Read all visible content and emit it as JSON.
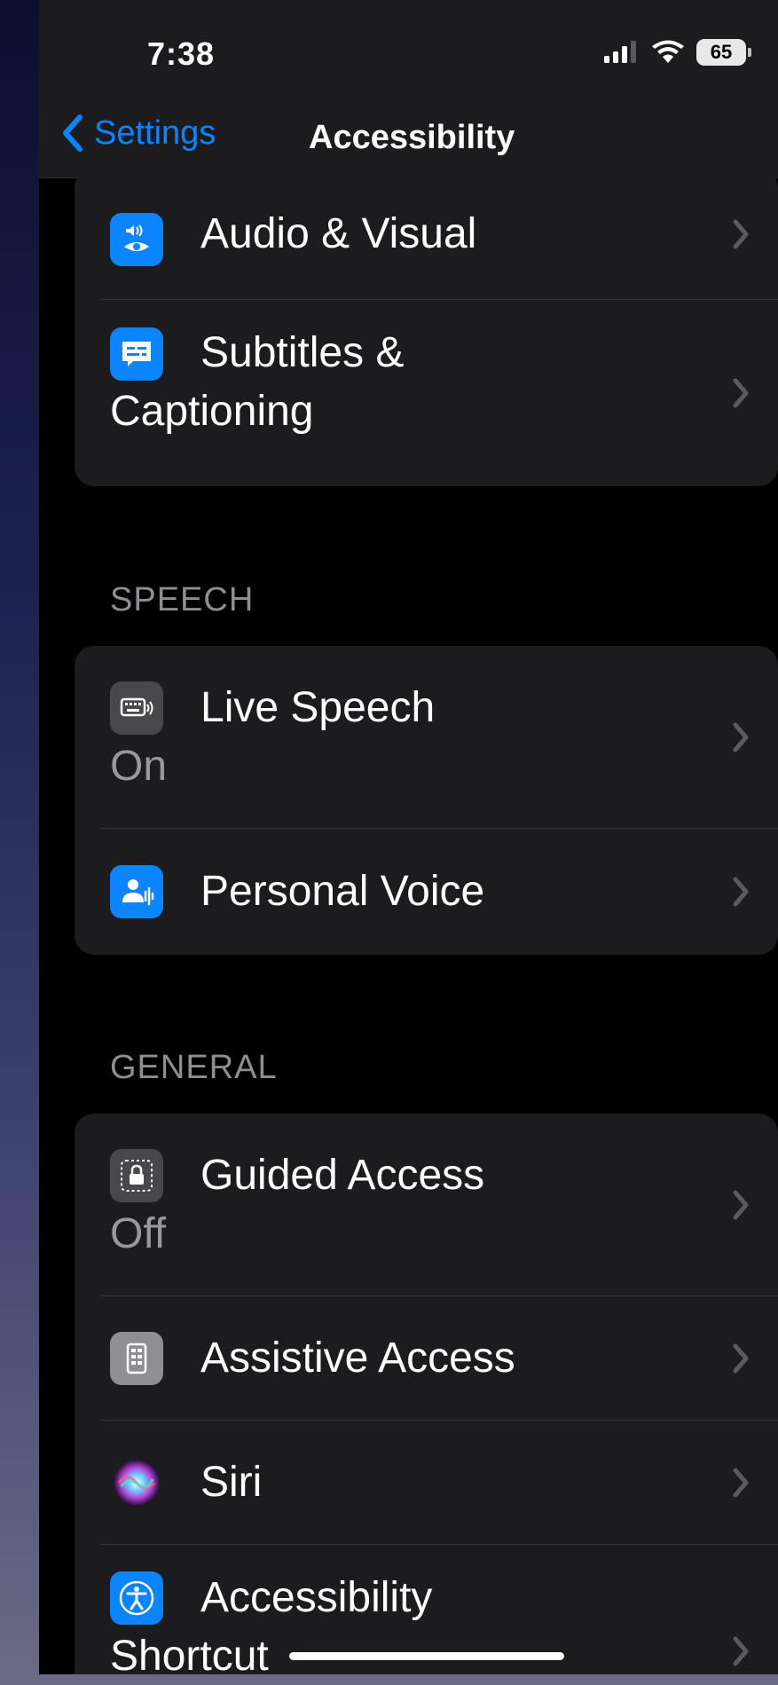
{
  "status_bar": {
    "time": "7:38",
    "battery": "65",
    "icons": [
      "signal-icon",
      "wifi-icon",
      "battery-icon"
    ]
  },
  "nav": {
    "back_label": "Settings",
    "title": "Accessibility"
  },
  "colors": {
    "accent": "#0a84ff",
    "background": "#000000",
    "cell": "#1c1c1e",
    "secondary_text": "#98989d"
  },
  "groups": {
    "hearing": {
      "items": [
        {
          "label": "Audio & Visual",
          "icon": "audio-visual-icon",
          "icon_color": "#0a84ff"
        },
        {
          "label_line1": "Subtitles &",
          "label_line2": "Captioning",
          "icon": "subtitles-icon",
          "icon_color": "#0a84ff"
        }
      ]
    },
    "speech": {
      "header": "SPEECH",
      "items": [
        {
          "label": "Live Speech",
          "value": "On",
          "icon": "keyboard-speech-icon",
          "icon_color": "#48484a"
        },
        {
          "label": "Personal Voice",
          "icon": "personal-voice-icon",
          "icon_color": "#0a84ff"
        }
      ]
    },
    "general": {
      "header": "GENERAL",
      "items": [
        {
          "label": "Guided Access",
          "value": "Off",
          "icon": "guided-access-icon",
          "icon_color": "#48484a"
        },
        {
          "label": "Assistive Access",
          "icon": "assistive-access-icon",
          "icon_color": "#8e8e93"
        },
        {
          "label": "Siri",
          "icon": "siri-icon",
          "icon_color": "#1c1c1e"
        },
        {
          "label_line1": "Accessibility",
          "label_line2": "Shortcut",
          "icon": "accessibility-shortcut-icon",
          "icon_color": "#0a84ff"
        }
      ]
    }
  }
}
